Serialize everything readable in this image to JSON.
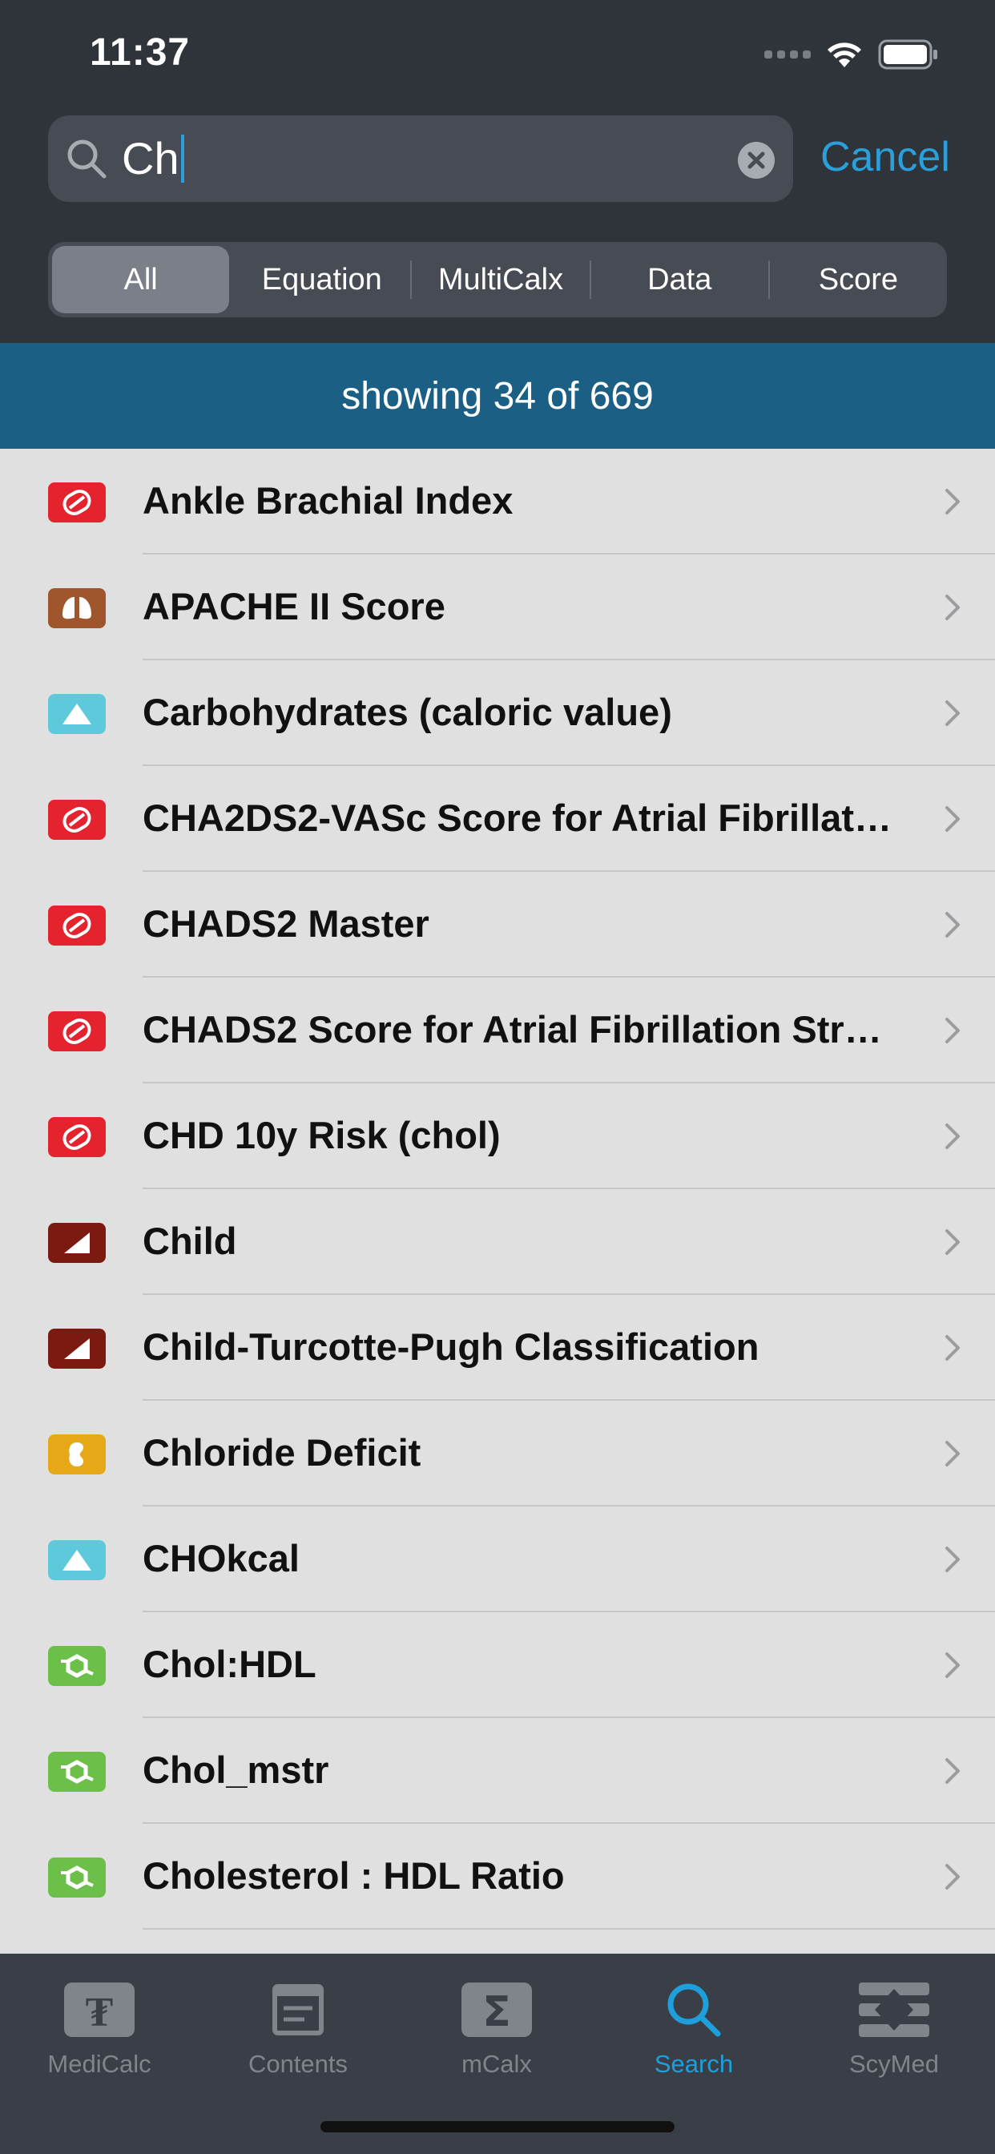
{
  "status_bar": {
    "time": "11:37"
  },
  "search": {
    "query": "Ch",
    "cancel_label": "Cancel"
  },
  "segments": [
    "All",
    "Equation",
    "MultiCalx",
    "Data",
    "Score"
  ],
  "banner": {
    "text": "showing 34 of 669"
  },
  "results": [
    {
      "label": "Ankle Brachial Index",
      "icon": "heart-icon",
      "color": "#e5232e"
    },
    {
      "label": "APACHE II Score",
      "icon": "lungs-icon",
      "color": "#a0562c"
    },
    {
      "label": "Carbohydrates (caloric value)",
      "icon": "triangle-icon",
      "color": "#5fc9dc"
    },
    {
      "label": "CHA2DS2-VASc Score for Atrial Fibrillat…",
      "icon": "heart-icon",
      "color": "#e5232e"
    },
    {
      "label": "CHADS2 Master",
      "icon": "heart-icon",
      "color": "#e5232e"
    },
    {
      "label": "CHADS2 Score for Atrial Fibrillation Str…",
      "icon": "heart-icon",
      "color": "#e5232e"
    },
    {
      "label": "CHD 10y Risk (chol)",
      "icon": "heart-icon",
      "color": "#e5232e"
    },
    {
      "label": "Child",
      "icon": "liver-icon",
      "color": "#7a1a10"
    },
    {
      "label": "Child-Turcotte-Pugh Classification",
      "icon": "liver-icon",
      "color": "#7a1a10"
    },
    {
      "label": "Chloride Deficit",
      "icon": "kidney-icon",
      "color": "#e6a817"
    },
    {
      "label": "CHOkcal",
      "icon": "triangle-icon",
      "color": "#5fc9dc"
    },
    {
      "label": "Chol:HDL",
      "icon": "molecule-icon",
      "color": "#6cc04a"
    },
    {
      "label": "Chol_mstr",
      "icon": "molecule-icon",
      "color": "#6cc04a"
    },
    {
      "label": "Cholesterol : HDL Ratio",
      "icon": "molecule-icon",
      "color": "#6cc04a"
    }
  ],
  "tabs": [
    {
      "label": "MediCalc",
      "icon": "medicalc-icon",
      "active": false
    },
    {
      "label": "Contents",
      "icon": "contents-icon",
      "active": false
    },
    {
      "label": "mCalx",
      "icon": "sigma-icon",
      "active": false
    },
    {
      "label": "Search",
      "icon": "search-icon",
      "active": true
    },
    {
      "label": "ScyMed",
      "icon": "scymed-icon",
      "active": false
    }
  ],
  "colors": {
    "accent": "#2b9fd9",
    "banner": "#1b5f85",
    "header": "#2f343b"
  }
}
